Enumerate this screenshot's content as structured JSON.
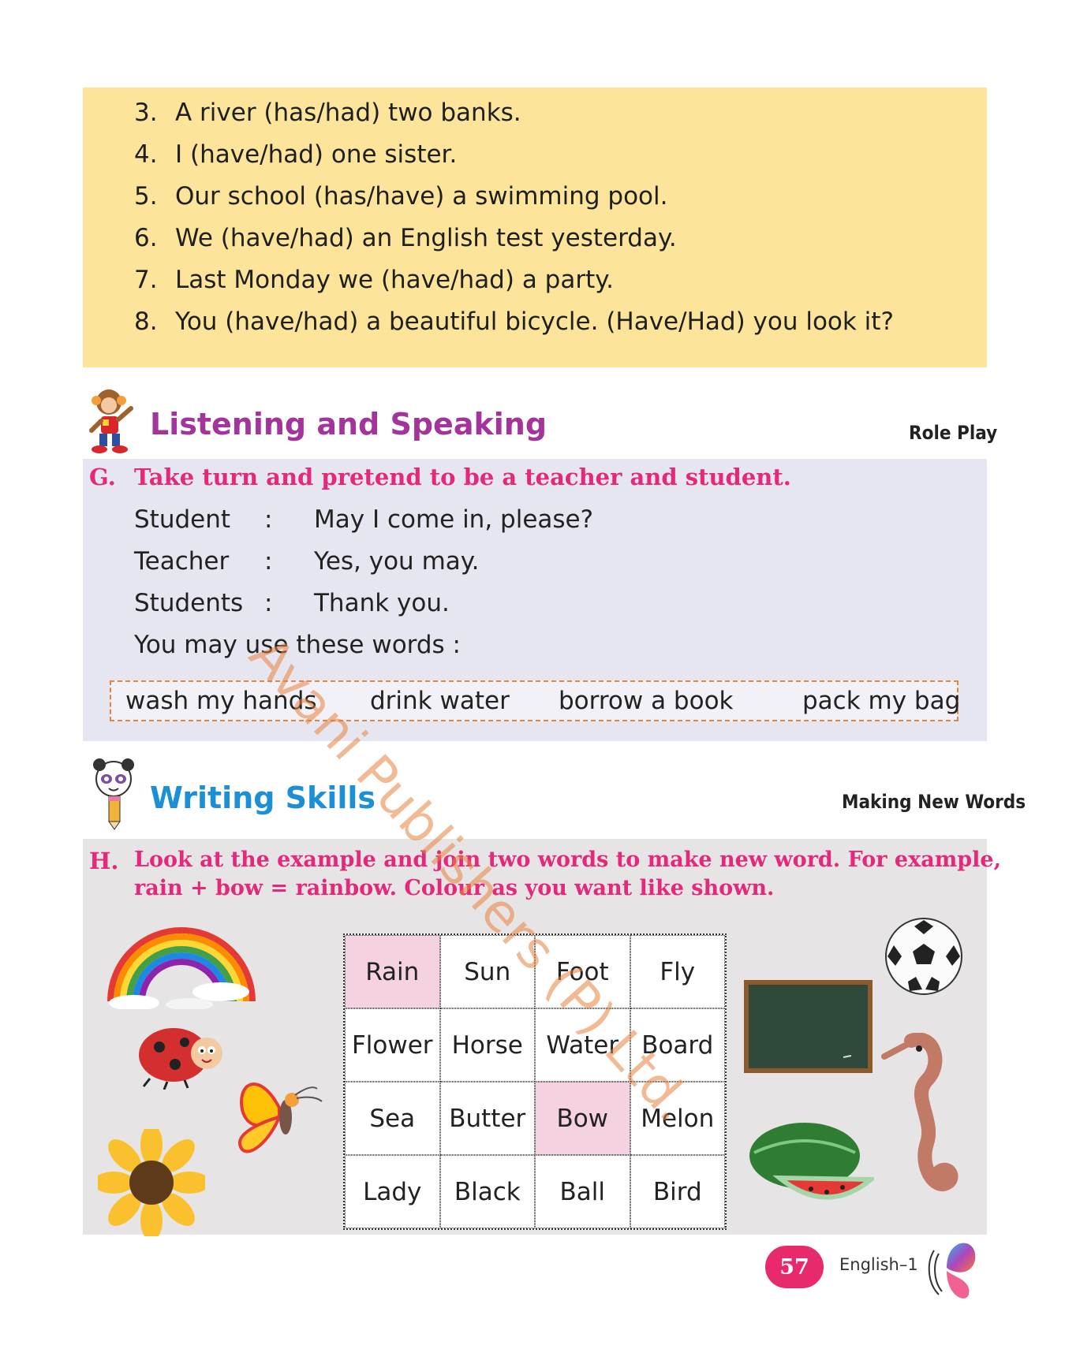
{
  "grammar": {
    "items": [
      {
        "num": "3.",
        "text": "A river (has/had) two banks."
      },
      {
        "num": "4.",
        "text": "I (have/had) one sister."
      },
      {
        "num": "5.",
        "text": "Our school (has/have) a swimming pool."
      },
      {
        "num": "6.",
        "text": "We (have/had) an English test yesterday."
      },
      {
        "num": "7.",
        "text": "Last Monday we (have/had) a party."
      },
      {
        "num": "8.",
        "text": "You (have/had) a beautiful bicycle. (Have/Had) you look it?"
      }
    ]
  },
  "listening": {
    "title": "Listening and Speaking",
    "tag": "Role Play",
    "title_color": "#a3349b"
  },
  "g": {
    "label": "G.",
    "instruction": "Take turn and pretend to be a teacher and student.",
    "dialogue": [
      {
        "speaker": "Student",
        "sep": ":",
        "line": "May I come in, please?"
      },
      {
        "speaker": "Teacher",
        "sep": ":",
        "line": "Yes, you may."
      },
      {
        "speaker": "Students",
        "sep": ":",
        "line": "Thank you."
      }
    ],
    "use_words": "You may use these words :",
    "words": [
      "wash my hands",
      "drink water",
      "borrow a book",
      "pack my bag"
    ]
  },
  "writing": {
    "title": "Writing Skills",
    "tag": "Making New Words",
    "title_color": "#1c8fd6"
  },
  "h": {
    "label": "H.",
    "instruction_line1": "Look at the example and join two words to make new word. For example,",
    "instruction_line2": "rain + bow = rainbow.  Colour as you want like shown.",
    "grid": [
      "Rain",
      "Sun",
      "Foot",
      "Fly",
      "Flower",
      "Horse",
      "Water",
      "Board",
      "Sea",
      "Butter",
      "Bow",
      "Melon",
      "Lady",
      "Black",
      "Ball",
      "Bird"
    ],
    "highlighted": [
      "Rain",
      "Bow"
    ]
  },
  "footer": {
    "page_number": "57",
    "book": "English–1"
  },
  "watermark": "Avani Publishers (P) Ltd."
}
